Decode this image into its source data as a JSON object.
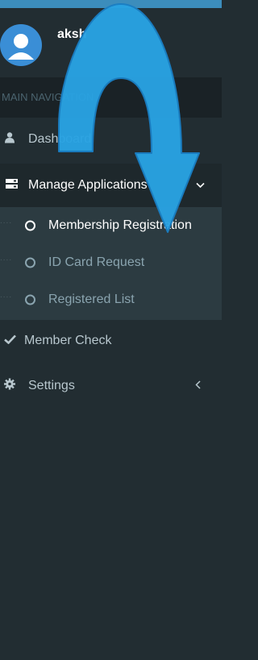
{
  "user": {
    "name": "aksh"
  },
  "nav": {
    "header": "MAIN NAVIGATION",
    "items": [
      {
        "label": "Dashboard",
        "icon": "user-icon"
      },
      {
        "label": "Manage Applications",
        "icon": "server-icon",
        "caret": "chevron-down-icon"
      },
      {
        "label": "Member Check",
        "icon": "check-icon"
      },
      {
        "label": "Settings",
        "icon": "gear-icon",
        "caret": "chevron-left-icon"
      }
    ],
    "submenu": [
      {
        "label": "Membership Registration",
        "active": true
      },
      {
        "label": "ID Card Request",
        "active": false
      },
      {
        "label": "Registered List",
        "active": false
      }
    ]
  },
  "colors": {
    "sidebar_bg": "#222d32",
    "submenu_bg": "#2c3b41",
    "accent": "#3c8dbc",
    "arrow": "#29a3e3"
  }
}
